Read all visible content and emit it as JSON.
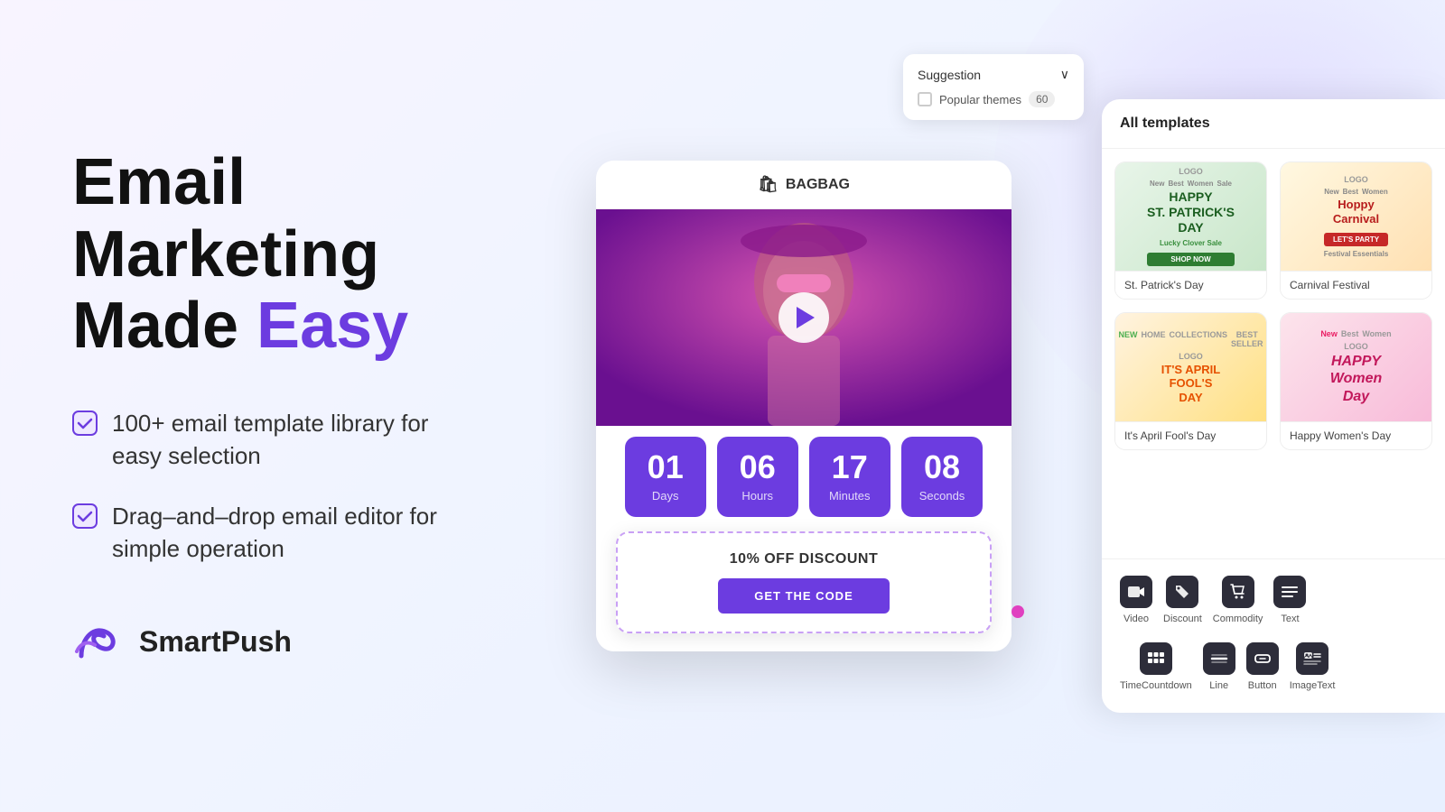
{
  "hero": {
    "title_line1": "Email Marketing",
    "title_line2_static": "Made ",
    "title_line2_highlight": "Easy",
    "features": [
      {
        "id": "f1",
        "text": "100+ email template library for easy selection"
      },
      {
        "id": "f2",
        "text": "Drag–and–drop email editor for simple operation"
      }
    ]
  },
  "logo": {
    "name": "SmartPush"
  },
  "suggestion_panel": {
    "title": "Suggestion",
    "option": "Popular themes",
    "toggle_value": "60"
  },
  "email_preview": {
    "brand_name": "BAGBAG",
    "bag_icon": "🛍"
  },
  "countdown": {
    "days": {
      "value": "01",
      "label": "Days"
    },
    "hours": {
      "value": "06",
      "label": "Hours"
    },
    "minutes": {
      "value": "17",
      "label": "Minutes"
    },
    "seconds": {
      "value": "08",
      "label": "Seconds"
    }
  },
  "discount_card": {
    "title": "10% OFF DISCOUNT",
    "button_label": "GET THE CODE"
  },
  "templates_panel": {
    "header": "All templates",
    "items": [
      {
        "id": "t1",
        "name": "St. Patrick's Day",
        "theme": "stpatricks"
      },
      {
        "id": "t2",
        "name": "Carnival Festival",
        "theme": "carnival"
      },
      {
        "id": "t3",
        "name": "It's April Fool's Day",
        "theme": "aprilfool"
      },
      {
        "id": "t4",
        "name": "Happy Women's Day",
        "theme": "womensday"
      }
    ]
  },
  "widgets": [
    {
      "id": "w1",
      "label": "Video",
      "icon": "▶"
    },
    {
      "id": "w2",
      "label": "Discount",
      "icon": "🏷"
    },
    {
      "id": "w3",
      "label": "Commodity",
      "icon": "🛍"
    },
    {
      "id": "w4",
      "label": "Text",
      "icon": "≡"
    },
    {
      "id": "w5",
      "label": "TimeCountdown",
      "icon": "⏱"
    },
    {
      "id": "w6",
      "label": "Line",
      "icon": "—"
    },
    {
      "id": "w7",
      "label": "Button",
      "icon": "▭"
    },
    {
      "id": "w8",
      "label": "ImageText",
      "icon": "🖼"
    }
  ]
}
